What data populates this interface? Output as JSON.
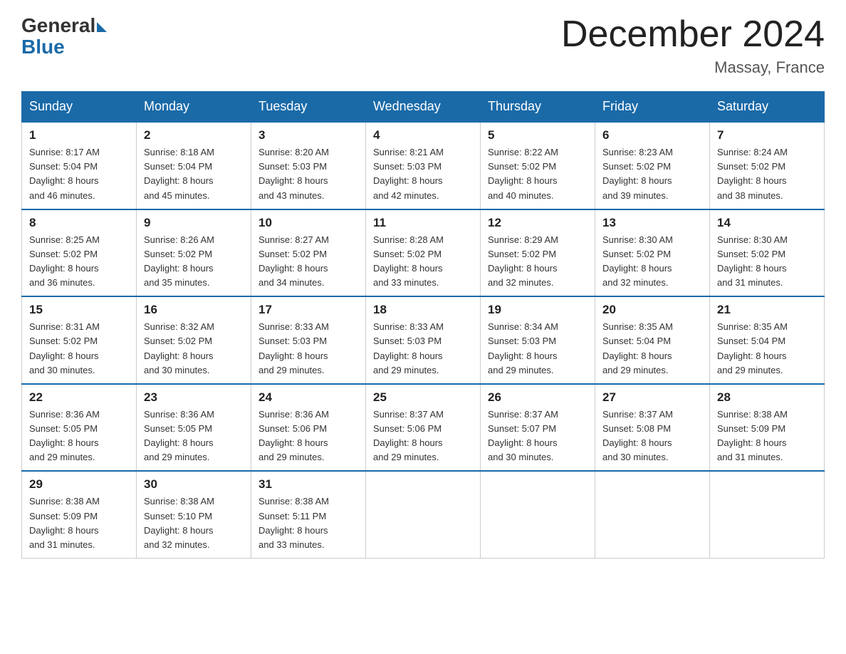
{
  "header": {
    "logo_general": "General",
    "logo_blue": "Blue",
    "month_title": "December 2024",
    "location": "Massay, France"
  },
  "weekdays": [
    "Sunday",
    "Monday",
    "Tuesday",
    "Wednesday",
    "Thursday",
    "Friday",
    "Saturday"
  ],
  "weeks": [
    [
      {
        "day": "1",
        "sunrise": "8:17 AM",
        "sunset": "5:04 PM",
        "daylight_hours": "8 hours",
        "daylight_minutes": "46 minutes."
      },
      {
        "day": "2",
        "sunrise": "8:18 AM",
        "sunset": "5:04 PM",
        "daylight_hours": "8 hours",
        "daylight_minutes": "45 minutes."
      },
      {
        "day": "3",
        "sunrise": "8:20 AM",
        "sunset": "5:03 PM",
        "daylight_hours": "8 hours",
        "daylight_minutes": "43 minutes."
      },
      {
        "day": "4",
        "sunrise": "8:21 AM",
        "sunset": "5:03 PM",
        "daylight_hours": "8 hours",
        "daylight_minutes": "42 minutes."
      },
      {
        "day": "5",
        "sunrise": "8:22 AM",
        "sunset": "5:02 PM",
        "daylight_hours": "8 hours",
        "daylight_minutes": "40 minutes."
      },
      {
        "day": "6",
        "sunrise": "8:23 AM",
        "sunset": "5:02 PM",
        "daylight_hours": "8 hours",
        "daylight_minutes": "39 minutes."
      },
      {
        "day": "7",
        "sunrise": "8:24 AM",
        "sunset": "5:02 PM",
        "daylight_hours": "8 hours",
        "daylight_minutes": "38 minutes."
      }
    ],
    [
      {
        "day": "8",
        "sunrise": "8:25 AM",
        "sunset": "5:02 PM",
        "daylight_hours": "8 hours",
        "daylight_minutes": "36 minutes."
      },
      {
        "day": "9",
        "sunrise": "8:26 AM",
        "sunset": "5:02 PM",
        "daylight_hours": "8 hours",
        "daylight_minutes": "35 minutes."
      },
      {
        "day": "10",
        "sunrise": "8:27 AM",
        "sunset": "5:02 PM",
        "daylight_hours": "8 hours",
        "daylight_minutes": "34 minutes."
      },
      {
        "day": "11",
        "sunrise": "8:28 AM",
        "sunset": "5:02 PM",
        "daylight_hours": "8 hours",
        "daylight_minutes": "33 minutes."
      },
      {
        "day": "12",
        "sunrise": "8:29 AM",
        "sunset": "5:02 PM",
        "daylight_hours": "8 hours",
        "daylight_minutes": "32 minutes."
      },
      {
        "day": "13",
        "sunrise": "8:30 AM",
        "sunset": "5:02 PM",
        "daylight_hours": "8 hours",
        "daylight_minutes": "32 minutes."
      },
      {
        "day": "14",
        "sunrise": "8:30 AM",
        "sunset": "5:02 PM",
        "daylight_hours": "8 hours",
        "daylight_minutes": "31 minutes."
      }
    ],
    [
      {
        "day": "15",
        "sunrise": "8:31 AM",
        "sunset": "5:02 PM",
        "daylight_hours": "8 hours",
        "daylight_minutes": "30 minutes."
      },
      {
        "day": "16",
        "sunrise": "8:32 AM",
        "sunset": "5:02 PM",
        "daylight_hours": "8 hours",
        "daylight_minutes": "30 minutes."
      },
      {
        "day": "17",
        "sunrise": "8:33 AM",
        "sunset": "5:03 PM",
        "daylight_hours": "8 hours",
        "daylight_minutes": "29 minutes."
      },
      {
        "day": "18",
        "sunrise": "8:33 AM",
        "sunset": "5:03 PM",
        "daylight_hours": "8 hours",
        "daylight_minutes": "29 minutes."
      },
      {
        "day": "19",
        "sunrise": "8:34 AM",
        "sunset": "5:03 PM",
        "daylight_hours": "8 hours",
        "daylight_minutes": "29 minutes."
      },
      {
        "day": "20",
        "sunrise": "8:35 AM",
        "sunset": "5:04 PM",
        "daylight_hours": "8 hours",
        "daylight_minutes": "29 minutes."
      },
      {
        "day": "21",
        "sunrise": "8:35 AM",
        "sunset": "5:04 PM",
        "daylight_hours": "8 hours",
        "daylight_minutes": "29 minutes."
      }
    ],
    [
      {
        "day": "22",
        "sunrise": "8:36 AM",
        "sunset": "5:05 PM",
        "daylight_hours": "8 hours",
        "daylight_minutes": "29 minutes."
      },
      {
        "day": "23",
        "sunrise": "8:36 AM",
        "sunset": "5:05 PM",
        "daylight_hours": "8 hours",
        "daylight_minutes": "29 minutes."
      },
      {
        "day": "24",
        "sunrise": "8:36 AM",
        "sunset": "5:06 PM",
        "daylight_hours": "8 hours",
        "daylight_minutes": "29 minutes."
      },
      {
        "day": "25",
        "sunrise": "8:37 AM",
        "sunset": "5:06 PM",
        "daylight_hours": "8 hours",
        "daylight_minutes": "29 minutes."
      },
      {
        "day": "26",
        "sunrise": "8:37 AM",
        "sunset": "5:07 PM",
        "daylight_hours": "8 hours",
        "daylight_minutes": "30 minutes."
      },
      {
        "day": "27",
        "sunrise": "8:37 AM",
        "sunset": "5:08 PM",
        "daylight_hours": "8 hours",
        "daylight_minutes": "30 minutes."
      },
      {
        "day": "28",
        "sunrise": "8:38 AM",
        "sunset": "5:09 PM",
        "daylight_hours": "8 hours",
        "daylight_minutes": "31 minutes."
      }
    ],
    [
      {
        "day": "29",
        "sunrise": "8:38 AM",
        "sunset": "5:09 PM",
        "daylight_hours": "8 hours",
        "daylight_minutes": "31 minutes."
      },
      {
        "day": "30",
        "sunrise": "8:38 AM",
        "sunset": "5:10 PM",
        "daylight_hours": "8 hours",
        "daylight_minutes": "32 minutes."
      },
      {
        "day": "31",
        "sunrise": "8:38 AM",
        "sunset": "5:11 PM",
        "daylight_hours": "8 hours",
        "daylight_minutes": "33 minutes."
      },
      null,
      null,
      null,
      null
    ]
  ]
}
